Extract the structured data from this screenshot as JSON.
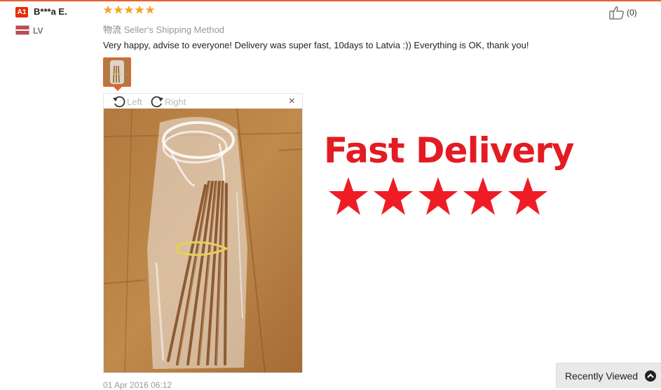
{
  "review": {
    "user_badge": "A1",
    "user_name": "B***a E.",
    "country": "LV",
    "rating": 5,
    "shipping_prefix": "物流",
    "shipping_method": "Seller's Shipping Method",
    "text": "Very happy, advise to everyone! Delivery was super fast, 10days to Latvia :)) Everything is OK, thank you!",
    "date": "01 Apr 2016 06:12",
    "likes": "(0)"
  },
  "viewer": {
    "rotate_left": "Left",
    "rotate_right": "Right",
    "close": "×"
  },
  "overlay": {
    "title": "Fast Delivery",
    "stars": 5,
    "color": "#e31b23"
  },
  "recently_viewed": {
    "label": "Recently Viewed"
  },
  "colors": {
    "accent": "#e4632e",
    "star": "#f5a623"
  },
  "icons": [
    "thumbs-up-icon",
    "rotate-left-icon",
    "rotate-right-icon",
    "close-icon",
    "chevron-up-icon",
    "star-icon"
  ]
}
